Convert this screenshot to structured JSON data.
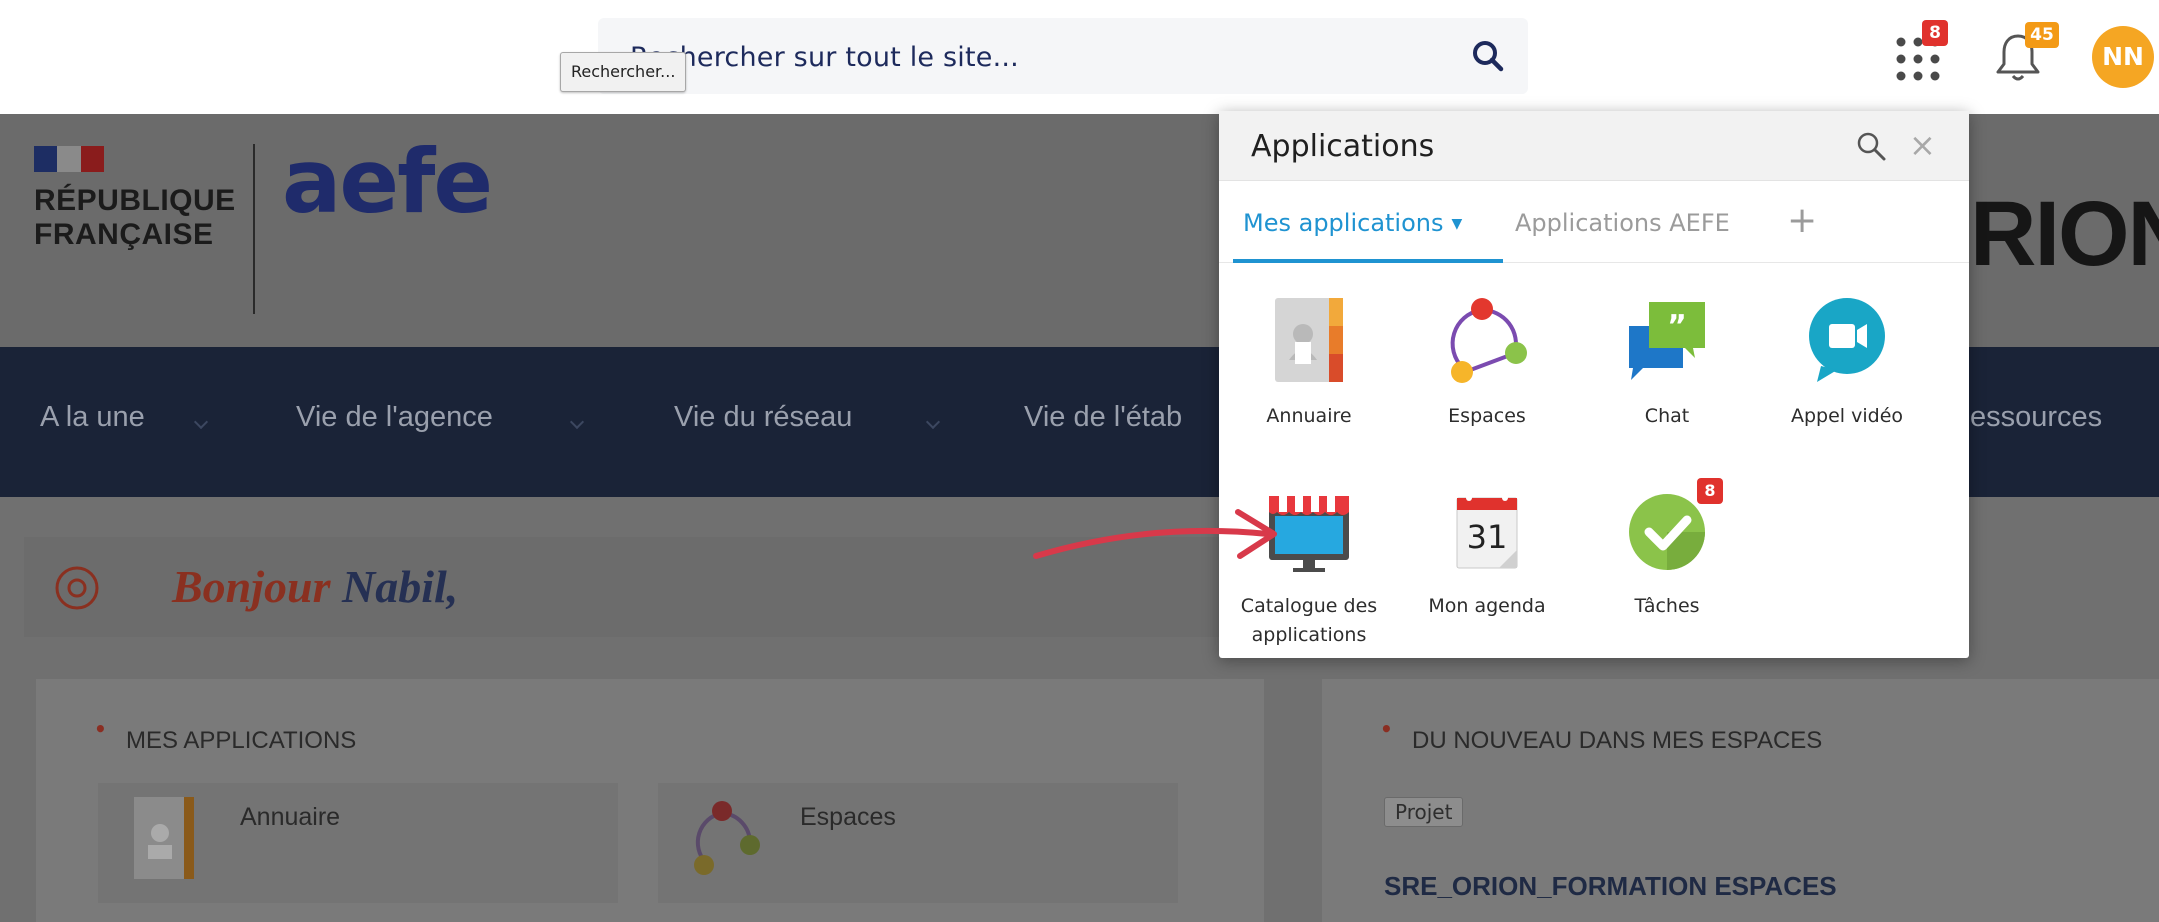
{
  "topbar": {
    "search_placeholder": "Rechercher sur tout le site...",
    "tooltip": "Rechercher...",
    "apps_badge": "8",
    "notifications_badge": "45",
    "avatar_initials": "NN"
  },
  "header": {
    "rf_line1": "RÉPUBLIQUE",
    "rf_line2": "FRANÇAISE",
    "aefe_word": "aefe",
    "orion_word": "RION"
  },
  "nav": {
    "items": [
      "A la une",
      "Vie de l'agence",
      "Vie du réseau",
      "Vie de l'étab",
      "essources"
    ]
  },
  "main": {
    "greeting_hello": "Bonjour",
    "greeting_name": "Nabil,",
    "apps_card_title": "MES APPLICATIONS",
    "apps_card_items": [
      "Annuaire",
      "Espaces"
    ],
    "news_card_title": "DU NOUVEAU DANS MES ESPACES",
    "news_tag": "Projet",
    "news_item_title": "SRE_ORION_FORMATION ESPACES"
  },
  "apps_panel": {
    "title": "Applications",
    "tabs": [
      "Mes applications",
      "Applications AEFE"
    ],
    "add_tab": "+",
    "close": "×",
    "apps": [
      {
        "label": "Annuaire",
        "icon": "address-book-icon"
      },
      {
        "label": "Espaces",
        "icon": "spaces-network-icon"
      },
      {
        "label": "Chat",
        "icon": "chat-bubble-icon"
      },
      {
        "label": "Appel vidéo",
        "icon": "video-call-icon"
      },
      {
        "label": "Catalogue des applications",
        "icon": "app-store-icon"
      },
      {
        "label": "Mon agenda",
        "icon": "calendar-icon",
        "icon_text": "31"
      },
      {
        "label": "Tâches",
        "icon": "check-tasks-icon",
        "badge": "8"
      }
    ]
  },
  "colors": {
    "accent_blue": "#1f93d1",
    "badge_red": "#e0322d",
    "badge_orange": "#f39a16",
    "avatar_bg": "#f5a623",
    "navbar": "#1a2337",
    "arrow": "#d8394a"
  }
}
